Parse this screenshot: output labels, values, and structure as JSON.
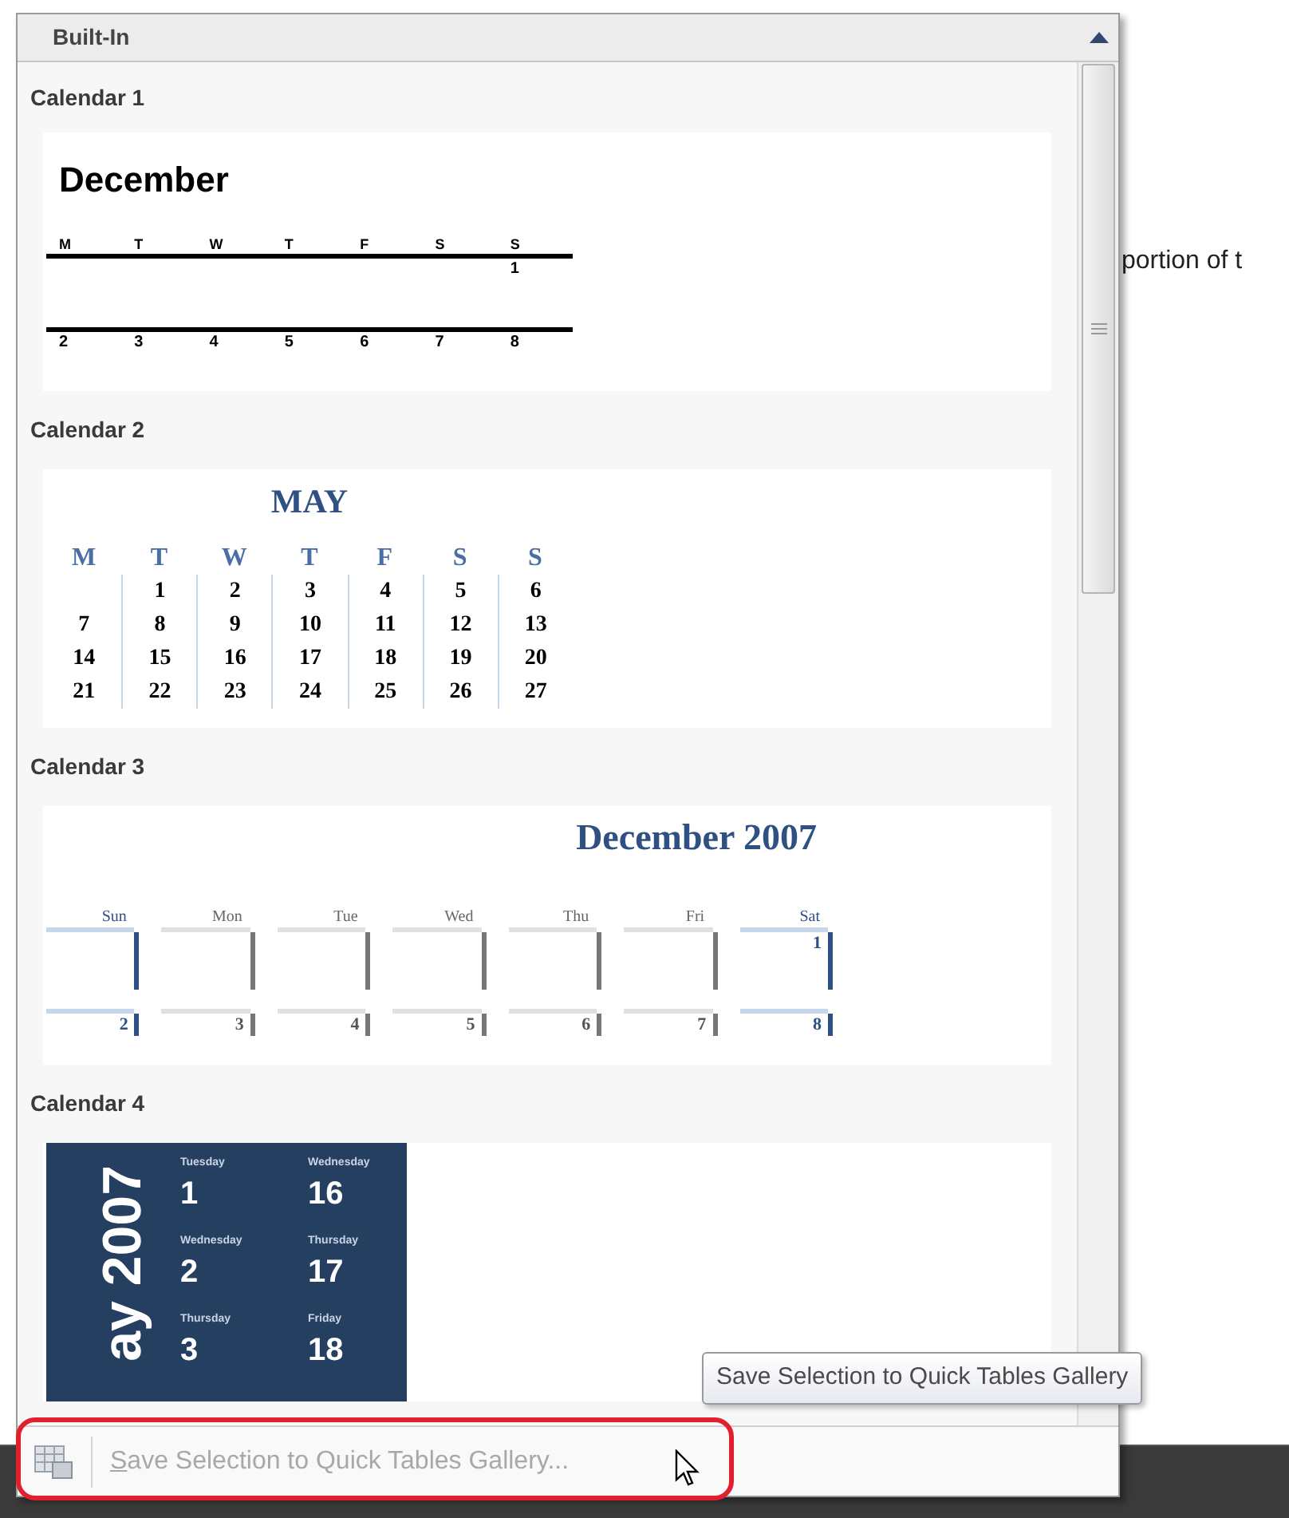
{
  "document": {
    "text": "portion of t"
  },
  "gallery": {
    "header": "Built-In",
    "items": [
      {
        "kind": "month-lines",
        "label": "Calendar 1",
        "title": "December",
        "weekdays": [
          {
            "text": "M"
          },
          {
            "text": "T"
          },
          {
            "text": "W"
          },
          {
            "text": "T"
          },
          {
            "text": "F"
          },
          {
            "text": "S"
          },
          {
            "text": "S"
          }
        ],
        "weeks": [
          [
            "1"
          ],
          [
            "2",
            "3",
            "4",
            "5",
            "6",
            "7",
            "8"
          ]
        ]
      },
      {
        "kind": "month-grid",
        "label": "Calendar 2",
        "title": "MAY",
        "weekdays": [
          {
            "text": "M"
          },
          {
            "text": "T"
          },
          {
            "text": "W"
          },
          {
            "text": "T"
          },
          {
            "text": "F"
          },
          {
            "text": "S"
          },
          {
            "text": "S"
          }
        ],
        "weeks": [
          [
            "1",
            "2",
            "3",
            "4",
            "5",
            "6"
          ],
          [
            "7",
            "8",
            "9",
            "10",
            "11",
            "12",
            "13"
          ],
          [
            "14",
            "15",
            "16",
            "17",
            "18",
            "19",
            "20"
          ],
          [
            "21",
            "22",
            "23",
            "24",
            "25",
            "26",
            "27"
          ]
        ]
      },
      {
        "kind": "month-boxes",
        "label": "Calendar 3",
        "title": "December 2007",
        "weekdays": [
          {
            "text": "Sun",
            "weekend": true
          },
          {
            "text": "Mon",
            "weekend": false
          },
          {
            "text": "Tue",
            "weekend": false
          },
          {
            "text": "Wed",
            "weekend": false
          },
          {
            "text": "Thu",
            "weekend": false
          },
          {
            "text": "Fri",
            "weekend": false
          },
          {
            "text": "Sat",
            "weekend": true
          }
        ],
        "weeks": [
          [
            "1"
          ],
          [
            "2",
            "3",
            "4",
            "5",
            "6",
            "7",
            "8"
          ]
        ]
      },
      {
        "kind": "date-list",
        "label": "Calendar 4",
        "title": "ay 2007",
        "entries": [
          {
            "day": "Tuesday",
            "date": "1"
          },
          {
            "day": "Wednesday",
            "date": "16"
          },
          {
            "day": "Wednesday",
            "date": "2"
          },
          {
            "day": "Thursday",
            "date": "17"
          },
          {
            "day": "Thursday",
            "date": "3"
          },
          {
            "day": "Friday",
            "date": "18"
          }
        ]
      }
    ]
  },
  "footer_item": {
    "label": "Save Selection to Quick Tables Gallery...",
    "disabled": true
  },
  "tooltip": {
    "text": "Save Selection to Quick Tables Gallery"
  }
}
